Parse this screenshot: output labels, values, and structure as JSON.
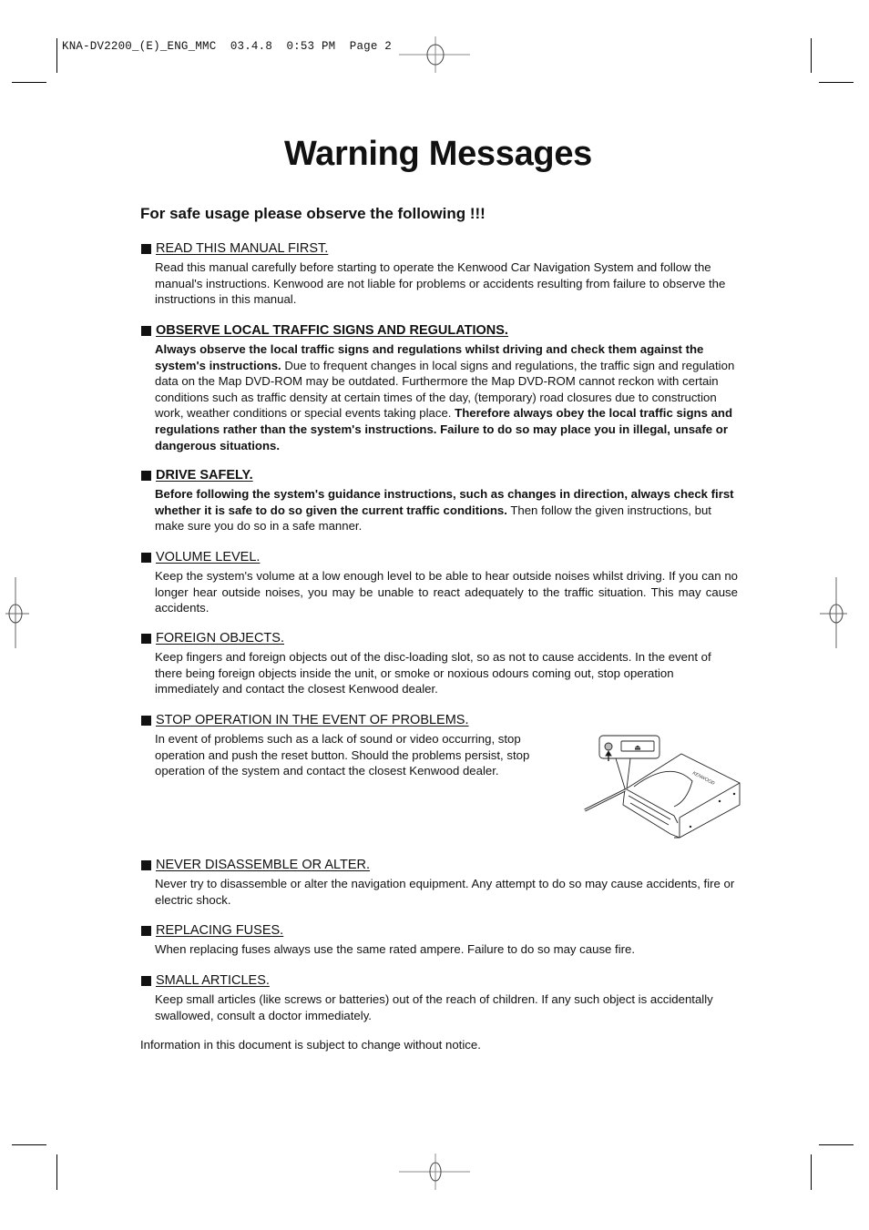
{
  "print_slug": "KNA-DV2200_(E)_ENG_MMC  03.4.8  0:53 PM  Page 2",
  "title": "Warning Messages",
  "subtitle": "For safe usage please observe the following !!!",
  "sections": [
    {
      "heading": "READ THIS MANUAL FIRST.",
      "heading_bold": false,
      "body": [
        {
          "bold": false,
          "text": "Read this manual carefully before starting to operate the Kenwood Car Navigation System and follow the manual's instructions. Kenwood are not liable for problems or accidents resulting from failure to observe the instructions in this manual."
        }
      ]
    },
    {
      "heading": "OBSERVE LOCAL TRAFFIC SIGNS AND REGULATIONS.",
      "heading_bold": true,
      "body": [
        {
          "bold": true,
          "text": "Always observe the local traffic signs and regulations whilst driving and check them against the system's instructions."
        },
        {
          "bold": false,
          "text": " Due to frequent changes in local signs and regulations, the traffic sign and regulation data on the Map DVD-ROM may be outdated. Furthermore the Map DVD-ROM cannot reckon with certain conditions such as traffic density at certain times of the day, (temporary) road closures due to construction work, weather conditions or special events taking place. "
        },
        {
          "bold": true,
          "text": "Therefore always obey the local traffic signs and regulations rather than the system's instructions. Failure to do so may place you in illegal, unsafe or dangerous situations."
        }
      ]
    },
    {
      "heading": "DRIVE SAFELY.",
      "heading_bold": true,
      "body": [
        {
          "bold": true,
          "text": "Before following the system's guidance instructions, such as changes in direction, always check first whether it is safe to do so given the current traffic conditions."
        },
        {
          "bold": false,
          "text": " Then follow the given instructions, but make sure you do so in a safe manner."
        }
      ]
    },
    {
      "heading": "VOLUME LEVEL.",
      "heading_bold": false,
      "body": [
        {
          "bold": false,
          "text": "Keep the system's volume at a low enough level to be able to hear outside noises whilst driving. If you can no longer hear outside noises, you may be unable to react adequately to the traffic situation. This may cause accidents."
        }
      ]
    },
    {
      "heading": "FOREIGN OBJECTS.",
      "heading_bold": false,
      "body": [
        {
          "bold": false,
          "text": "Keep fingers and foreign objects out of the disc-loading slot, so as not to cause accidents. In the event of there being foreign objects inside the unit, or smoke or noxious odours coming out, stop operation immediately and contact the closest Kenwood dealer."
        }
      ]
    },
    {
      "heading": "STOP OPERATION IN THE EVENT OF PROBLEMS.",
      "heading_bold": false,
      "body": [
        {
          "bold": false,
          "text": "In event of problems such as a lack of sound or video occurring, stop operation and push the reset button. Should the problems persist, stop operation of the system and contact the closest Kenwood dealer."
        }
      ]
    },
    {
      "heading": "NEVER DISASSEMBLE OR ALTER.",
      "heading_bold": false,
      "body": [
        {
          "bold": false,
          "text": "Never try to disassemble or alter the navigation equipment. Any attempt to do so may cause accidents, fire or electric shock."
        }
      ]
    },
    {
      "heading": "REPLACING FUSES.",
      "heading_bold": false,
      "body": [
        {
          "bold": false,
          "text": "When replacing fuses always use the same rated ampere. Failure to do so may cause fire."
        }
      ]
    },
    {
      "heading": "SMALL ARTICLES.",
      "heading_bold": false,
      "body": [
        {
          "bold": false,
          "text": "Keep small articles (like screws or batteries) out of the reach of children. If any such object is accidentally swallowed, consult a doctor immediately."
        }
      ]
    }
  ],
  "illustration": {
    "description": "reset-button-illustration",
    "brand_mark": "KENWOOD",
    "eject_symbol": "⏏"
  },
  "footer_note": "Information in this document is subject to change without notice."
}
